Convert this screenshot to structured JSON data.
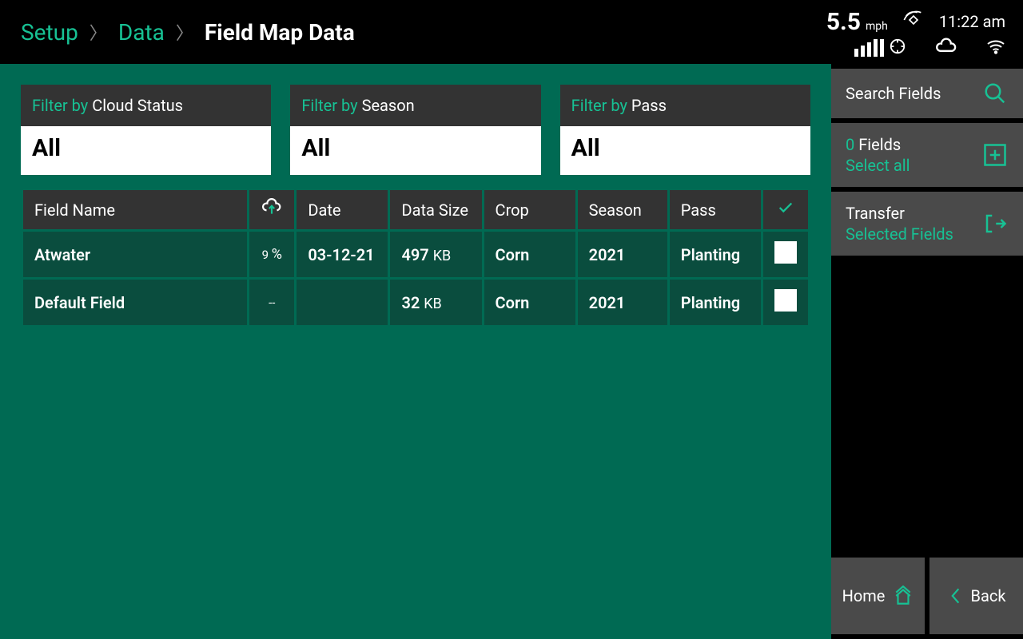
{
  "status": {
    "speed": "5.5",
    "speed_unit": "mph",
    "time": "11:22 am"
  },
  "breadcrumb": {
    "item1": "Setup",
    "item2": "Data",
    "current": "Field Map Data"
  },
  "filters": [
    {
      "label_prefix": "Filter by",
      "label": "Cloud Status",
      "value": "All"
    },
    {
      "label_prefix": "Filter by",
      "label": "Season",
      "value": "All"
    },
    {
      "label_prefix": "Filter by",
      "label": "Pass",
      "value": "All"
    }
  ],
  "table": {
    "headers": {
      "name": "Field Name",
      "date": "Date",
      "size": "Data Size",
      "crop": "Crop",
      "season": "Season",
      "pass": "Pass"
    },
    "rows": [
      {
        "name": "Atwater",
        "sync": "9",
        "sync_unit": "%",
        "date": "03-12-21",
        "size": "497",
        "size_unit": "KB",
        "crop": "Corn",
        "season": "2021",
        "pass": "Planting"
      },
      {
        "name": "Default Field",
        "sync": "--",
        "sync_unit": "",
        "date": "",
        "size": "32",
        "size_unit": "KB",
        "crop": "Corn",
        "season": "2021",
        "pass": "Planting"
      }
    ]
  },
  "sidebar": {
    "search": "Search Fields",
    "select_count": "0",
    "select_label": "Fields",
    "select_all": "Select all",
    "transfer": "Transfer",
    "transfer_sub": "Selected Fields",
    "home": "Home",
    "back": "Back"
  }
}
